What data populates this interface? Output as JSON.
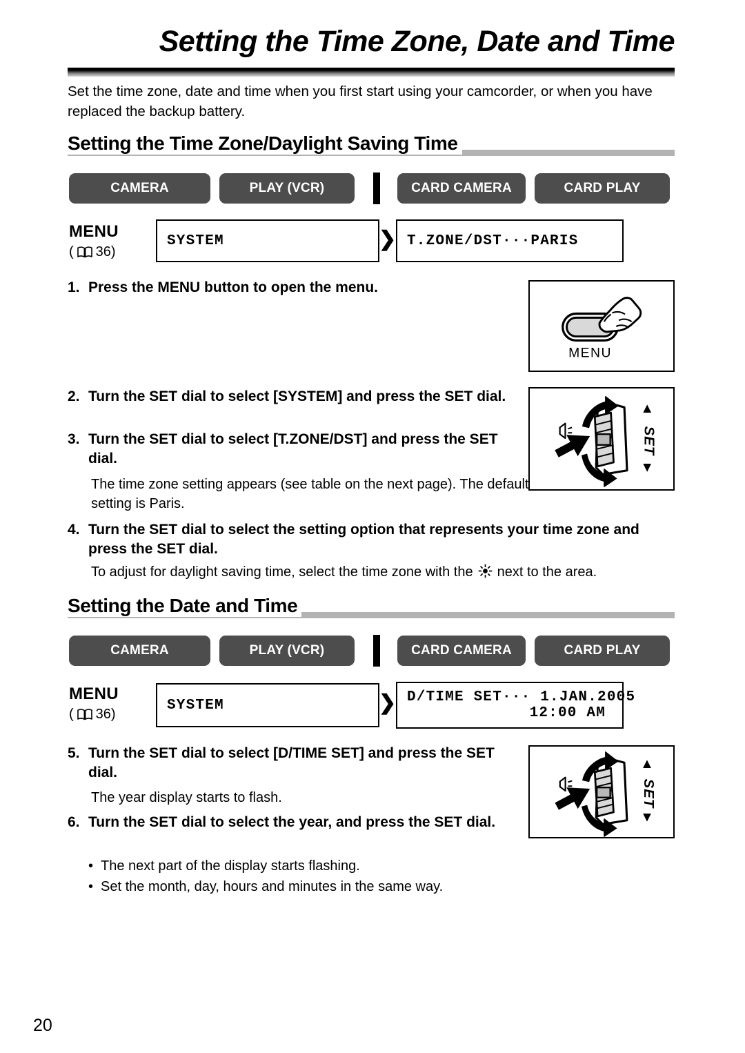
{
  "page": {
    "title": "Setting the Time Zone, Date and Time",
    "intro": "Set the time zone, date and time when you first start using your camcorder, or when you have replaced the backup battery.",
    "number": "20"
  },
  "colors": {
    "mode_button_bg": "#4d4d4d",
    "mode_button_text": "#ffffff",
    "section_bar": "#b3b3b3",
    "rule_dark": "#000000",
    "rule_light": "#d8d8d8"
  },
  "section1": {
    "heading": "Setting the Time Zone/Daylight Saving Time",
    "modes": [
      {
        "label": "CAMERA"
      },
      {
        "label": "PLAY (VCR)"
      },
      {
        "label": "CARD CAMERA"
      },
      {
        "label": "CARD PLAY"
      }
    ],
    "menu": {
      "label": "MENU",
      "ref_open": "(",
      "ref_page": "36",
      "ref_close": ")",
      "book_icon": "open-book-icon",
      "arrow_icon": "double-chevron-right-icon",
      "lcd_left": "SYSTEM",
      "lcd_right_line1": "T.ZONE/DST···PARIS"
    },
    "steps": [
      {
        "num": "1.",
        "text": "Press the MENU button to open the menu."
      },
      {
        "num": "2.",
        "text": "Turn the SET dial to select [SYSTEM] and press the SET dial."
      },
      {
        "num": "3.",
        "text": "Turn the SET dial to select [T.ZONE/DST] and press the SET dial.",
        "note": "The time zone setting appears (see table on the next page). The default setting is Paris."
      },
      {
        "num": "4.",
        "text": "Turn the SET dial to select the setting option that represents your time zone and press the SET dial.",
        "note_before_symbol": "To adjust for daylight saving time, select the time zone with the",
        "note_symbol": "dst-sun-icon",
        "note_after_symbol": "next to the area."
      }
    ],
    "illustrations": [
      {
        "name": "menu-button-press-illustration",
        "caption": "MENU"
      },
      {
        "name": "set-dial-turn-press-illustration",
        "caption": "SET"
      }
    ]
  },
  "section2": {
    "heading": "Setting the Date and Time",
    "modes": [
      {
        "label": "CAMERA"
      },
      {
        "label": "PLAY (VCR)"
      },
      {
        "label": "CARD CAMERA"
      },
      {
        "label": "CARD PLAY"
      }
    ],
    "menu": {
      "label": "MENU",
      "ref_open": "(",
      "ref_page": "36",
      "ref_close": ")",
      "book_icon": "open-book-icon",
      "arrow_icon": "double-chevron-right-icon",
      "lcd_left": "SYSTEM",
      "lcd_right_line1": "D/TIME SET··· 1.JAN.2005",
      "lcd_right_line2": "12:00 AM"
    },
    "steps": [
      {
        "num": "5.",
        "text": "Turn the SET dial to select [D/TIME SET] and press the SET dial.",
        "note": "The year display starts to flash."
      },
      {
        "num": "6.",
        "text": "Turn the SET dial to select the year, and press the SET dial.",
        "bullets": [
          "The next part of the display starts flashing.",
          "Set the month, day, hours and minutes in the same way."
        ]
      }
    ],
    "illustrations": [
      {
        "name": "set-dial-turn-press-illustration",
        "caption": "SET"
      }
    ]
  }
}
